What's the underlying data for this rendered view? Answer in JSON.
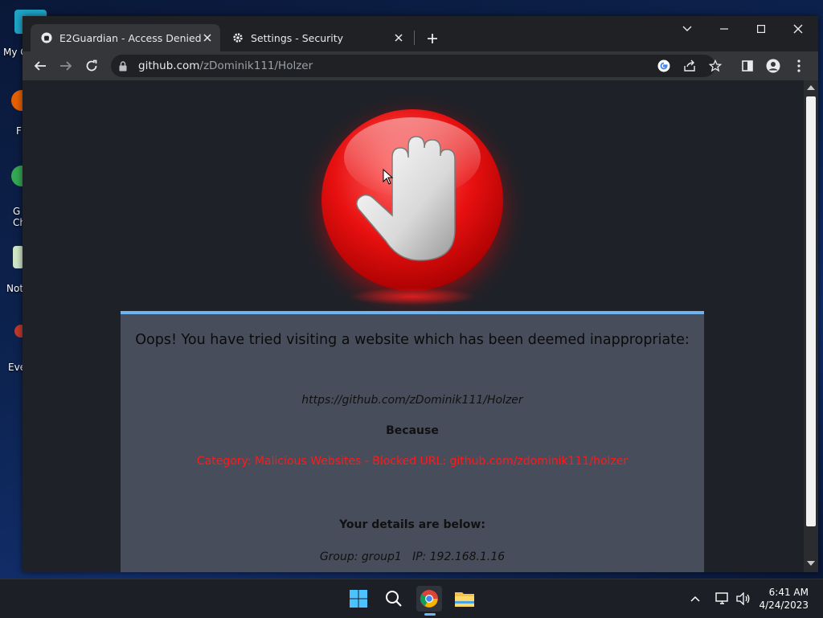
{
  "desktop": {
    "icons": [
      {
        "label": "My C"
      },
      {
        "label": "F"
      },
      {
        "label": "G\nCh"
      },
      {
        "label": "Not"
      },
      {
        "label": "Eve"
      }
    ]
  },
  "browser": {
    "tabs": [
      {
        "title": "E2Guardian - Access Denied",
        "icon": "github-icon",
        "active": true
      },
      {
        "title": "Settings - Security",
        "icon": "gear-icon",
        "active": false
      }
    ],
    "url_host": "github.com",
    "url_path": "/zDominik111/Holzer"
  },
  "page": {
    "headline": "Oops! You have tried visiting a website which has been deemed inappropriate:",
    "blocked_url": "https://github.com/zDominik111/Holzer",
    "because_label": "Because",
    "reason": "Category: Malicious Websites - Blocked URL: github.com/zdominik111/holzer",
    "details_heading": "Your details are below:",
    "details": "Group: group1   IP: 192.168.1.16"
  },
  "taskbar": {
    "time": "6:41 AM",
    "date": "4/24/2023"
  },
  "colors": {
    "accent_blue": "#6fb4f0",
    "reason_red": "#ff1a1a",
    "panel": "#474d5a"
  }
}
